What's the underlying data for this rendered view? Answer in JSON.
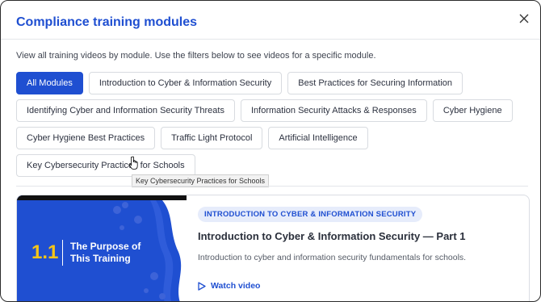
{
  "modal": {
    "title": "Compliance training modules",
    "intro": "View all training videos by module. Use the filters below to see videos for a specific module."
  },
  "filters": [
    {
      "label": "All Modules",
      "active": true
    },
    {
      "label": "Introduction to Cyber & Information Security",
      "active": false
    },
    {
      "label": "Best Practices for Securing Information",
      "active": false
    },
    {
      "label": "Identifying Cyber and Information Security Threats",
      "active": false
    },
    {
      "label": "Information Security Attacks & Responses",
      "active": false
    },
    {
      "label": "Cyber Hygiene",
      "active": false
    },
    {
      "label": "Cyber Hygiene Best Practices",
      "active": false
    },
    {
      "label": "Traffic Light Protocol",
      "active": false
    },
    {
      "label": "Artificial Intelligence",
      "active": false
    },
    {
      "label": "Key Cybersecurity Practices for Schools",
      "active": false
    }
  ],
  "tooltip": "Key Cybersecurity Practices for Schools",
  "video_card": {
    "thumbnail_number": "1.1",
    "thumbnail_title": "The Purpose of This Training",
    "module_badge": "INTRODUCTION TO CYBER & INFORMATION SECURITY",
    "title": "Introduction to Cyber & Information Security — Part 1",
    "description": "Introduction to cyber and information security fundamentals for schools.",
    "watch_label": "Watch video"
  },
  "icons": {
    "close": "close-icon",
    "play": "play-icon",
    "cursor": "hand-cursor-icon"
  },
  "colors": {
    "accent": "#1f4fd1",
    "thumbnail_yellow": "#f5c518"
  }
}
